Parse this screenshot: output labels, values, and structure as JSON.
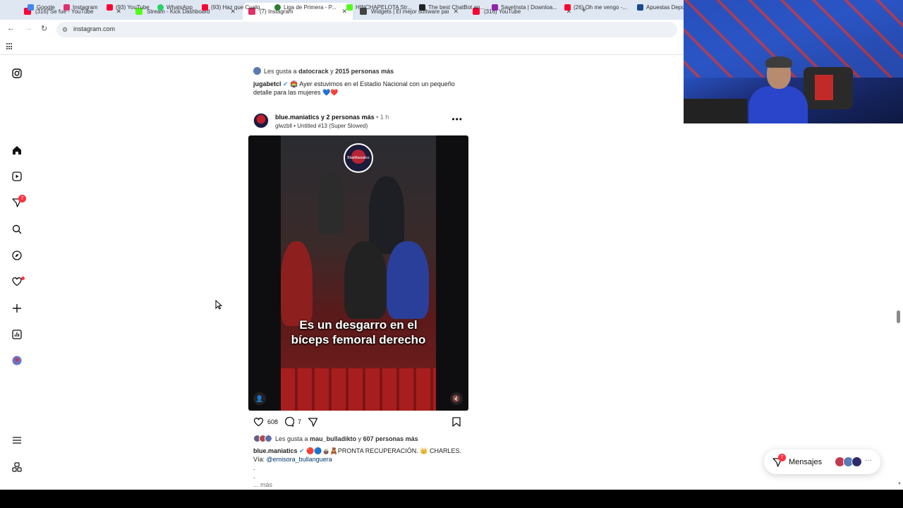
{
  "browser": {
    "tabs": [
      {
        "label": "(316) Se fué - YouTube",
        "color": "#ff0033"
      },
      {
        "label": "Stream - Kick Dashboard",
        "color": "#53fc18"
      },
      {
        "label": "(7) Instagram",
        "color": "#e1306c"
      },
      {
        "label": "Widgets | El mejor software para",
        "color": "#444444"
      },
      {
        "label": "(316) YouTube",
        "color": "#ff0033"
      }
    ],
    "url": "instagram.com",
    "bookmarks": [
      {
        "label": "Google",
        "color": "#4285f4"
      },
      {
        "label": "Instagram",
        "color": "#e1306c"
      },
      {
        "label": "(93) YouTube",
        "color": "#ff0033"
      },
      {
        "label": "WhatsApp",
        "color": "#25d366"
      },
      {
        "label": "(93) Haz que Cualq...",
        "color": "#ff0033"
      },
      {
        "label": "Liga de Primera - P...",
        "color": "#2e7d32"
      },
      {
        "label": "HINCHAPELOTA Str...",
        "color": "#53fc18"
      },
      {
        "label": "The best ChatBot an...",
        "color": "#222222"
      },
      {
        "label": "SaveInsta | Downloa...",
        "color": "#8e24aa"
      },
      {
        "label": "(26) Oh me vengo -...",
        "color": "#ff0033"
      },
      {
        "label": "Apuestas Depo",
        "color": "#1a4a8a"
      }
    ]
  },
  "sidenav": {
    "icons": [
      "instagram-logo-icon",
      "home-icon",
      "reels-icon",
      "messages-icon",
      "search-icon",
      "explore-icon",
      "heart-icon",
      "create-icon",
      "dashboard-icon",
      "profile-avatar-icon",
      "menu-icon",
      "meta-icon"
    ],
    "messages_badge": "7"
  },
  "prev_post": {
    "likes_prefix": "Les gusta a",
    "likes_user": "datocrack",
    "likes_mid": "y",
    "likes_count": "2015 personas más",
    "caption_user": "jugabetcl",
    "caption_text": "🏟️ Ayer estuvimos en el Estadio Nacional con un pequeño detalle para las mujeres 💙❤️"
  },
  "post": {
    "author": "blue.maniatics",
    "collab": "y 2 personas más",
    "time": "• 1 h",
    "sub_user": "glwzbll",
    "sub_audio": "• Untitled #13 (Super Slowed)",
    "more": "•••",
    "video_logo": "BlueManiatics",
    "video_subtitle": "Es un desgarro en el bíceps femoral derecho",
    "likes": "608",
    "comments": "7",
    "liked_by_prefix": "Les gusta a",
    "liked_by_user": "mau_bulladikto",
    "liked_by_mid": "y",
    "liked_by_count": "607 personas más",
    "caption_user": "blue.maniatics",
    "caption_text": "🔴🔵🧉🧸PRONTA RECUPERACIÓN. 👑 CHARLES.",
    "via_label": "Vía:",
    "via_link": "@emisora_bullanguera",
    "dot1": ".",
    "dot2": ".",
    "more_label": "... más"
  },
  "messages_pill": {
    "label": "Mensajes",
    "badge": "7",
    "avatar_colors": [
      "#c23a52",
      "#5a7bb5",
      "#2b2b6b"
    ],
    "dots": "···"
  },
  "colors": {
    "ig_red": "#ff3040",
    "link": "#00376b",
    "muted": "#737373"
  }
}
